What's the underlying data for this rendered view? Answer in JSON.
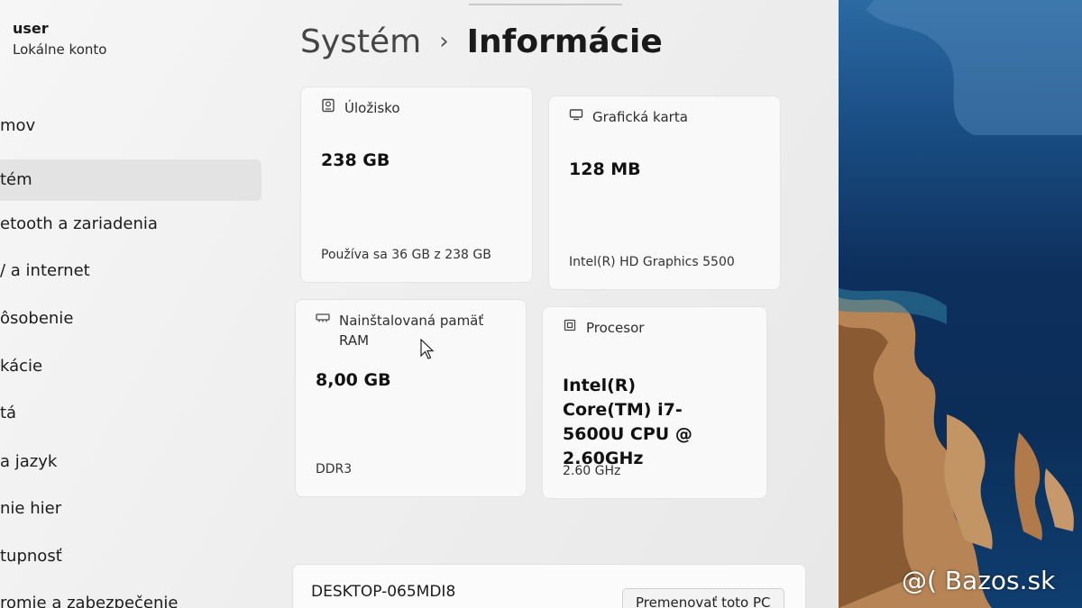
{
  "sidebar": {
    "user_name": "user",
    "user_account": "Lokálne konto",
    "items": [
      {
        "label": "mov"
      },
      {
        "label": "tém"
      },
      {
        "label": "etooth a zariadenia"
      },
      {
        "label": "/ a internet"
      },
      {
        "label": "ôsobenie"
      },
      {
        "label": "kácie"
      },
      {
        "label": "tá"
      },
      {
        "label": "a jazyk"
      },
      {
        "label": "nie hier"
      },
      {
        "label": "tupnosť"
      },
      {
        "label": "romie a zabezpečenie"
      }
    ]
  },
  "header": {
    "parent": "Systém",
    "separator": "›",
    "current": "Informácie"
  },
  "cards": {
    "storage": {
      "title": "Úložisko",
      "value": "238 GB",
      "detail": "Používa sa 36 GB z 238 GB",
      "icon": "storage-icon"
    },
    "graphics": {
      "title": "Grafická karta",
      "value": "128 MB",
      "detail": "Intel(R) HD Graphics 5500",
      "icon": "graphics-card-icon"
    },
    "ram": {
      "title": "Nainštalovaná pamäť RAM",
      "value": "8,00 GB",
      "detail": "DDR3",
      "icon": "memory-icon"
    },
    "processor": {
      "title": "Procesor",
      "value": "Intel(R) Core(TM) i7-5600U CPU @ 2.60GHz",
      "detail": "2.60 GHz",
      "icon": "processor-icon"
    }
  },
  "device": {
    "name": "DESKTOP-065MDI8",
    "rename_label": "Premenovať toto PC"
  },
  "watermark": "@( Bazos.sk"
}
